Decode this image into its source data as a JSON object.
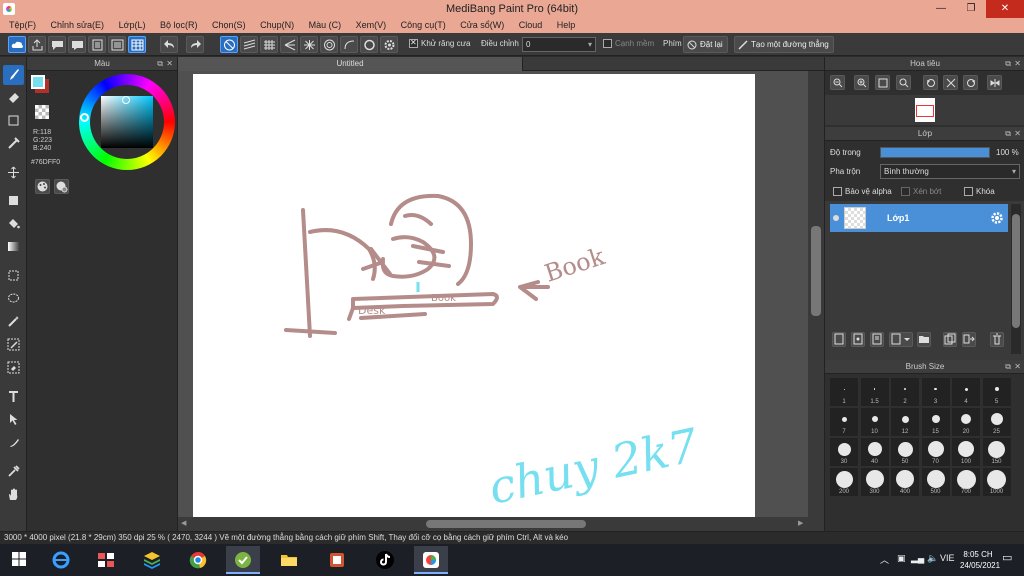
{
  "window": {
    "title": "MediBang Paint Pro (64bit)",
    "minimize": "—",
    "restore": "❐",
    "close": "✕"
  },
  "menu": [
    "Tệp(F)",
    "Chỉnh sửa(E)",
    "Lớp(L)",
    "Bộ lọc(R)",
    "Chọn(S)",
    "Chụp(N)",
    "Màu (C)",
    "Xem(V)",
    "Công cụ(T)",
    "Cửa sổ(W)",
    "Cloud",
    "Help"
  ],
  "toolbar": {
    "antialias_label": "Khử răng cưa",
    "adjust_label": "Điều chỉnh",
    "adjust_value": "0",
    "soft_edge_label": "Cạnh mềm",
    "keys_label": "Phím",
    "reset_label": "Đặt lại",
    "straight_line_label": "Tạo một đường thẳng"
  },
  "color_panel": {
    "title": "Màu",
    "r": "R:118",
    "g": "G:223",
    "b": "B:240",
    "hex": "#76DFF0",
    "primary_color": "#76DFF0",
    "secondary_color": "#B0302A"
  },
  "document": {
    "tab": "Untitled"
  },
  "canvas_text": {
    "book_label": "Book",
    "desk_label_1": "Desk",
    "desk_label_2": "Book",
    "signature": "chuy 2k7"
  },
  "navigator": {
    "title": "Hoa tiêu"
  },
  "layer_panel": {
    "title": "Lớp",
    "opacity_label": "Độ trong",
    "opacity_value": "100 %",
    "opacity_fraction": 1.0,
    "blend_label": "Pha trộn",
    "blend_value": "Bình thường",
    "protect_alpha": "Bảo vệ alpha",
    "clipping": "Xén bớt",
    "lock": "Khóa",
    "layers": [
      {
        "name": "Lớp1"
      }
    ]
  },
  "brush_size": {
    "title": "Brush Size",
    "sizes": [
      "1",
      "1.5",
      "2",
      "3",
      "4",
      "5",
      "7",
      "10",
      "12",
      "15",
      "20",
      "25",
      "30",
      "40",
      "50",
      "70",
      "100",
      "150",
      "200",
      "300",
      "400",
      "500",
      "700",
      "1000"
    ]
  },
  "statusbar": {
    "text": "3000 * 4000 pixel   (21.8 * 29cm)   350 dpi   25 %   ( 2470, 3244 )   Vẽ một đường thẳng bằng cách giữ phím Shift, Thay đổi cỡ cọ bằng cách giữ phím Ctrl, Alt và kéo"
  },
  "taskbar": {
    "language": "VIE",
    "time": "8:05 CH",
    "date": "24/05/2021"
  }
}
